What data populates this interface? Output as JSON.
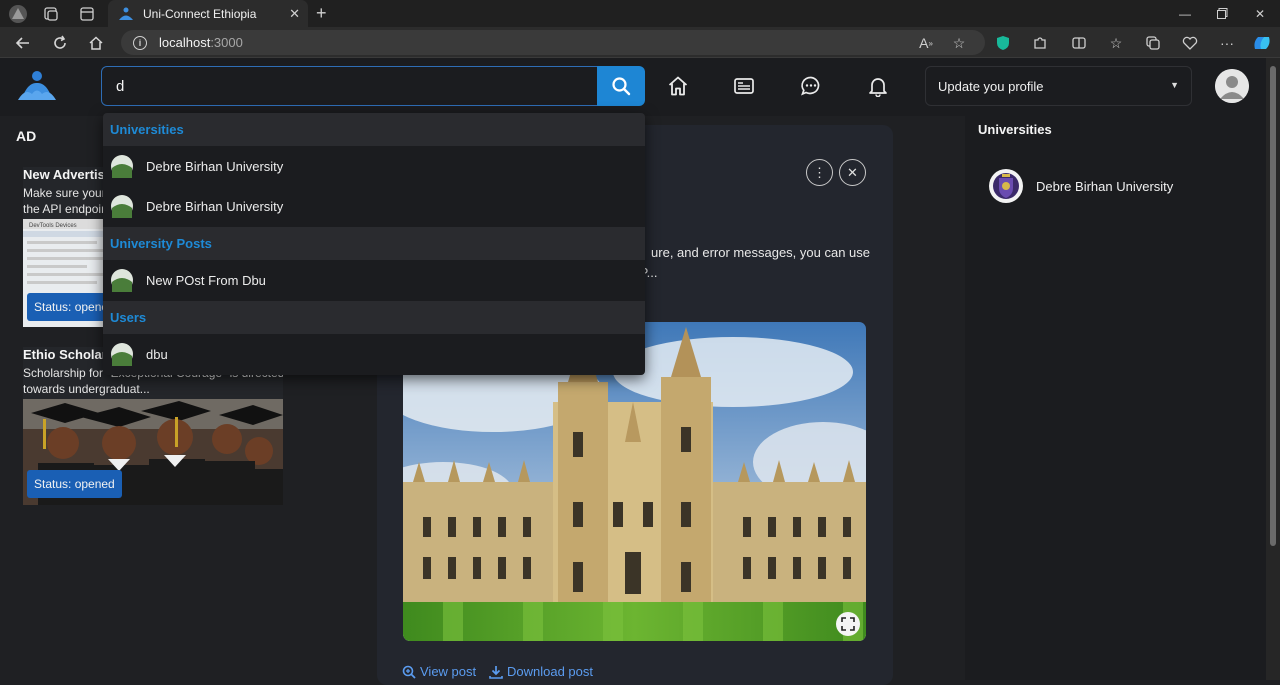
{
  "browser": {
    "tab_title": "Uni-Connect Ethiopia",
    "url_host": "localhost",
    "url_port": ":3000"
  },
  "header": {
    "search_value": "d",
    "profile_select": "Update you profile"
  },
  "ads": {
    "title": "AD",
    "cards": [
      {
        "heading": "New Advertis",
        "desc_line1": "Make sure your",
        "desc_line2": "the API endpoin",
        "status": "Status: opene"
      },
      {
        "heading": "Ethio Scholar",
        "desc_line1": "Scholarship for \"Exceptional Courage\" is directed",
        "desc_line2": "towards undergraduat...",
        "status": "Status: opened"
      }
    ]
  },
  "post": {
    "text_line1": "ure, and error messages, you can use",
    "text_line2": "u can enhance the CreateP...",
    "view_label": "View post",
    "download_label": "Download post"
  },
  "right_panel": {
    "title": "Universities",
    "items": [
      "Debre Birhan University"
    ]
  },
  "dropdown": {
    "sections": [
      {
        "label": "Universities",
        "items": [
          "Debre Birhan University",
          "Debre Birhan University"
        ]
      },
      {
        "label": "University Posts",
        "items": [
          "New POst From Dbu"
        ]
      },
      {
        "label": "Users",
        "items": [
          "dbu"
        ]
      }
    ]
  },
  "colors": {
    "accent": "#1e86d4",
    "section_text": "#1e8ad6",
    "status_pill": "#1a5fb4",
    "background": "#1f2023"
  }
}
